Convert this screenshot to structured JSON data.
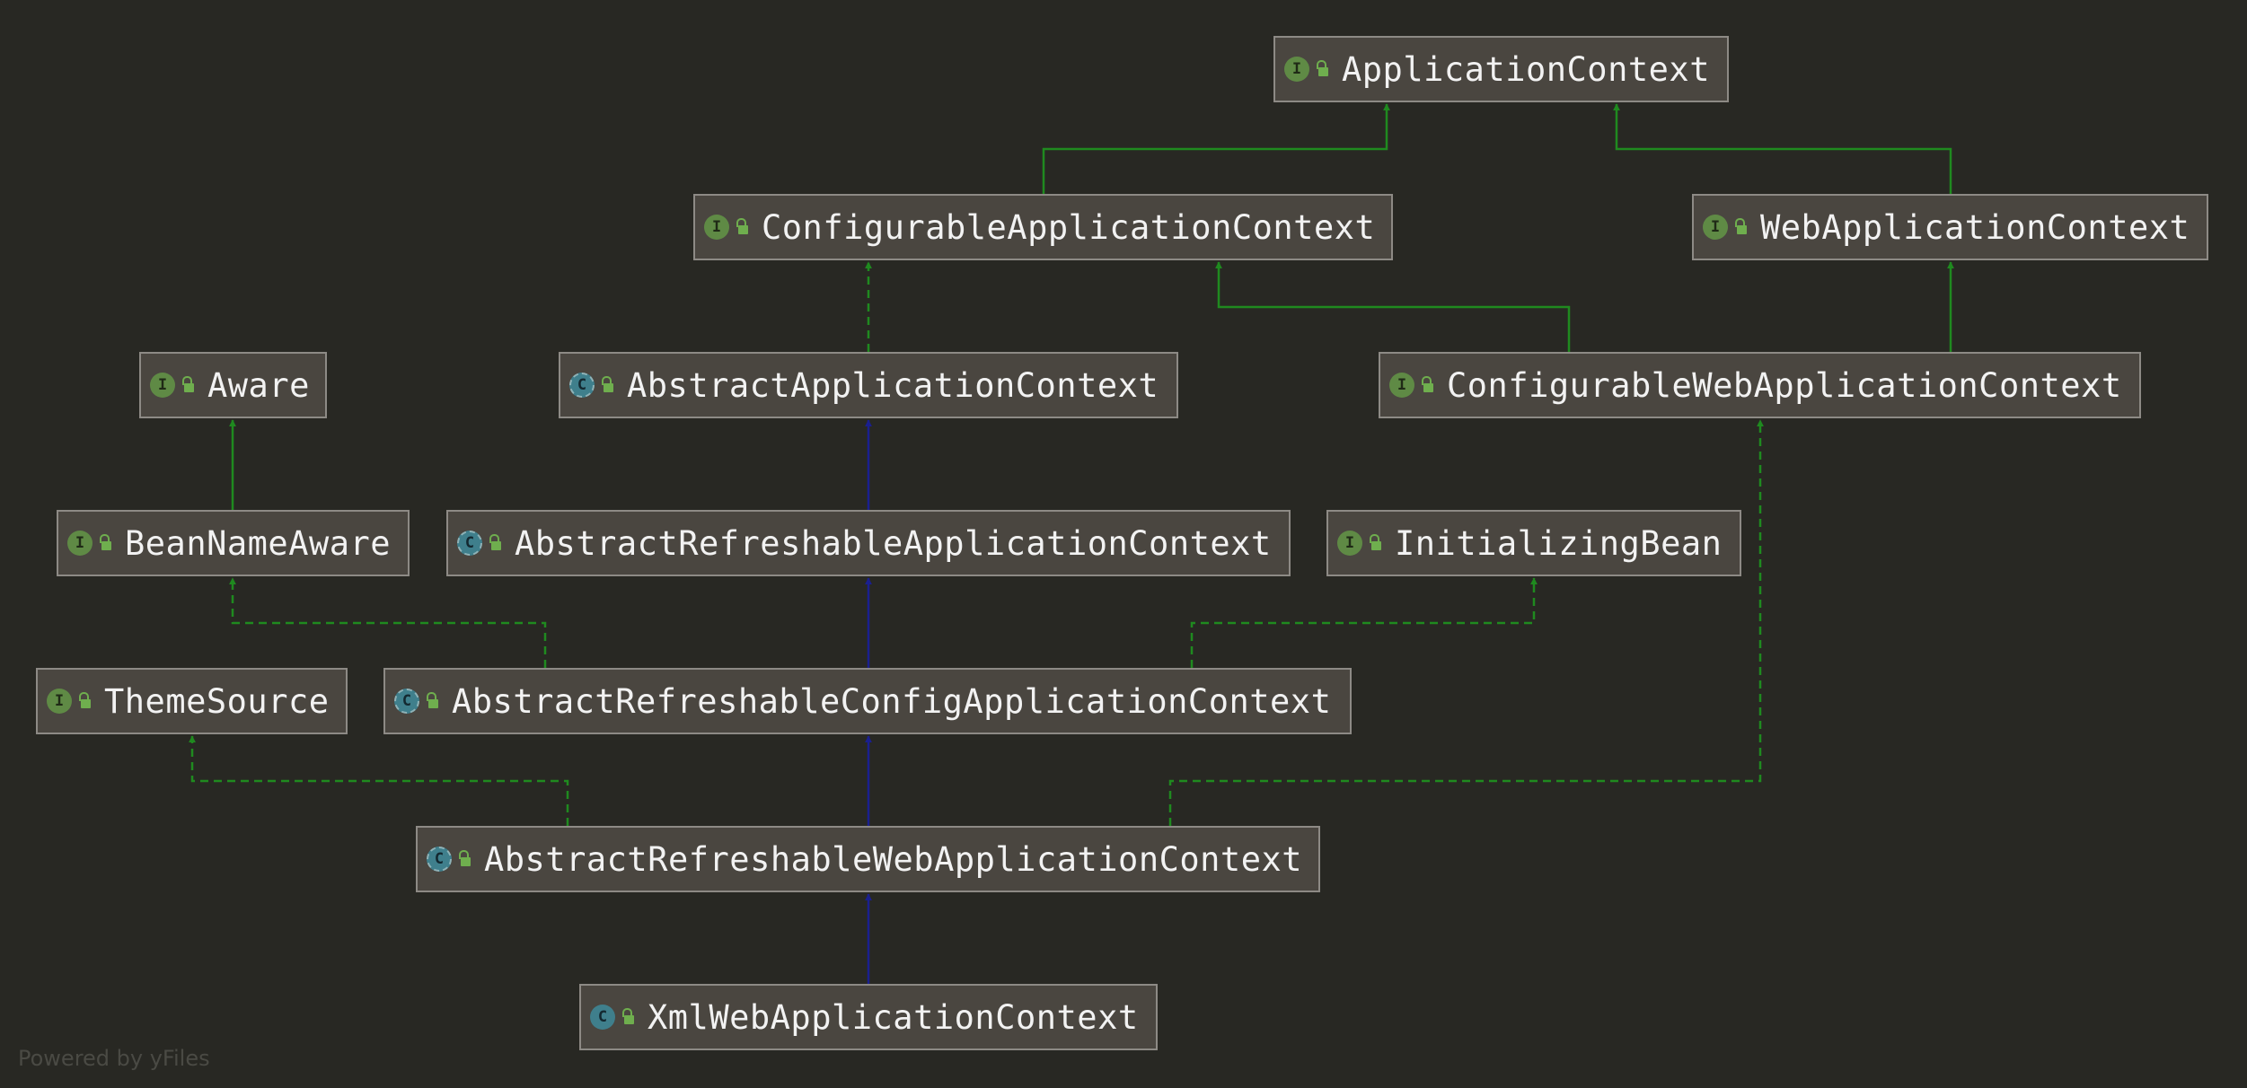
{
  "nodes": [
    {
      "id": "ApplicationContext",
      "label": "ApplicationContext",
      "kind": "interface",
      "kind_letter": "I"
    },
    {
      "id": "ConfigurableApplicationContext",
      "label": "ConfigurableApplicationContext",
      "kind": "interface",
      "kind_letter": "I"
    },
    {
      "id": "WebApplicationContext",
      "label": "WebApplicationContext",
      "kind": "interface",
      "kind_letter": "I"
    },
    {
      "id": "Aware",
      "label": "Aware",
      "kind": "interface",
      "kind_letter": "I"
    },
    {
      "id": "AbstractApplicationContext",
      "label": "AbstractApplicationContext",
      "kind": "abstract-class",
      "kind_letter": "C"
    },
    {
      "id": "ConfigurableWebApplicationContext",
      "label": "ConfigurableWebApplicationContext",
      "kind": "interface",
      "kind_letter": "I"
    },
    {
      "id": "BeanNameAware",
      "label": "BeanNameAware",
      "kind": "interface",
      "kind_letter": "I"
    },
    {
      "id": "AbstractRefreshableApplicationContext",
      "label": "AbstractRefreshableApplicationContext",
      "kind": "abstract-class",
      "kind_letter": "C"
    },
    {
      "id": "InitializingBean",
      "label": "InitializingBean",
      "kind": "interface",
      "kind_letter": "I"
    },
    {
      "id": "ThemeSource",
      "label": "ThemeSource",
      "kind": "interface",
      "kind_letter": "I"
    },
    {
      "id": "AbstractRefreshableConfigApplicationContext",
      "label": "AbstractRefreshableConfigApplicationContext",
      "kind": "abstract-class",
      "kind_letter": "C"
    },
    {
      "id": "AbstractRefreshableWebApplicationContext",
      "label": "AbstractRefreshableWebApplicationContext",
      "kind": "abstract-class",
      "kind_letter": "C"
    },
    {
      "id": "XmlWebApplicationContext",
      "label": "XmlWebApplicationContext",
      "kind": "class",
      "kind_letter": "C"
    }
  ],
  "edges": [
    {
      "from": "ConfigurableApplicationContext",
      "to": "ApplicationContext",
      "type": "interface-extends"
    },
    {
      "from": "WebApplicationContext",
      "to": "ApplicationContext",
      "type": "interface-extends"
    },
    {
      "from": "AbstractApplicationContext",
      "to": "ConfigurableApplicationContext",
      "type": "implements"
    },
    {
      "from": "ConfigurableWebApplicationContext",
      "to": "ConfigurableApplicationContext",
      "type": "interface-extends"
    },
    {
      "from": "ConfigurableWebApplicationContext",
      "to": "WebApplicationContext",
      "type": "interface-extends"
    },
    {
      "from": "BeanNameAware",
      "to": "Aware",
      "type": "interface-extends"
    },
    {
      "from": "AbstractRefreshableApplicationContext",
      "to": "AbstractApplicationContext",
      "type": "class-extends"
    },
    {
      "from": "AbstractRefreshableConfigApplicationContext",
      "to": "AbstractRefreshableApplicationContext",
      "type": "class-extends"
    },
    {
      "from": "AbstractRefreshableConfigApplicationContext",
      "to": "BeanNameAware",
      "type": "implements"
    },
    {
      "from": "AbstractRefreshableConfigApplicationContext",
      "to": "InitializingBean",
      "type": "implements"
    },
    {
      "from": "AbstractRefreshableWebApplicationContext",
      "to": "AbstractRefreshableConfigApplicationContext",
      "type": "class-extends"
    },
    {
      "from": "AbstractRefreshableWebApplicationContext",
      "to": "ThemeSource",
      "type": "implements"
    },
    {
      "from": "AbstractRefreshableWebApplicationContext",
      "to": "ConfigurableWebApplicationContext",
      "type": "implements"
    },
    {
      "from": "XmlWebApplicationContext",
      "to": "AbstractRefreshableWebApplicationContext",
      "type": "class-extends"
    }
  ],
  "colors": {
    "background": "#282823",
    "node_fill": "#4a4640",
    "node_border": "#8d8a85",
    "node_text": "#f2f2f2",
    "interface_edge": "#1f8a1f",
    "class_edge": "#1a1f8f",
    "interface_icon": "#5f8a45",
    "class_icon": "#3f7f8c",
    "visibility_icon": "#6fae4e"
  },
  "icons": {
    "interface": "interface-icon",
    "abstract-class": "abstract-class-icon",
    "class": "class-icon",
    "visibility": "public-lock-icon"
  },
  "watermark": "Powered by yFiles"
}
